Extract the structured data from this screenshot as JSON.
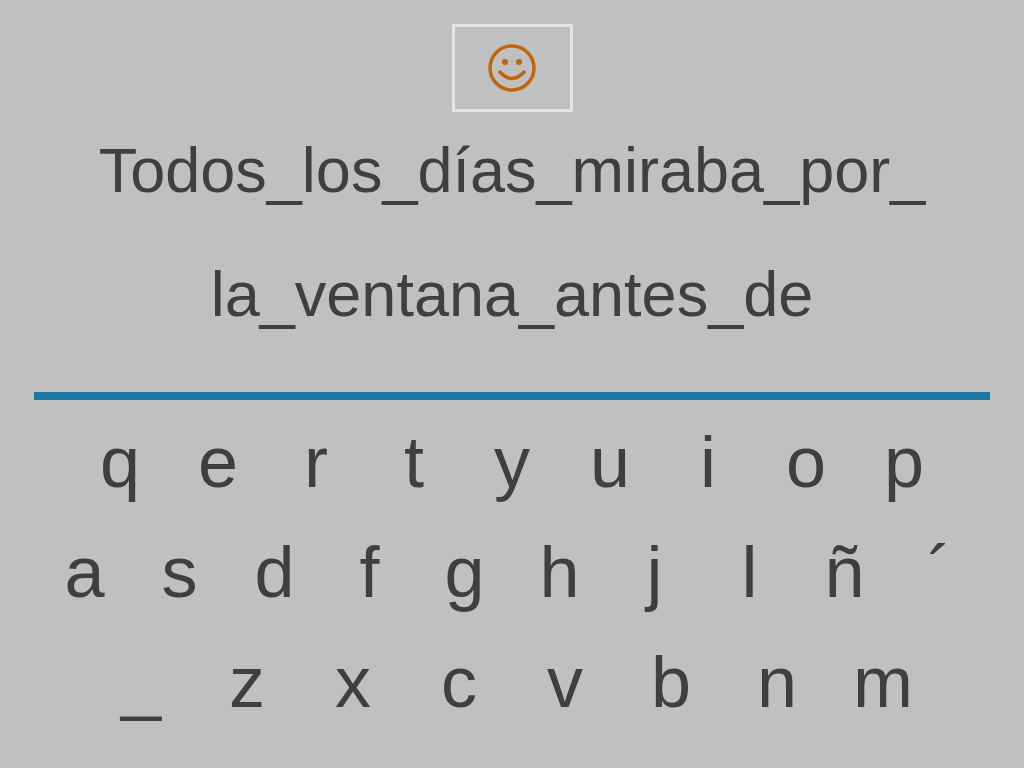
{
  "sentence_lines": [
    "Todos_los_días_miraba_por_",
    "la_ventana_antes_de"
  ],
  "keyboard_rows": [
    [
      "q",
      "e",
      "r",
      "t",
      "y",
      "u",
      "i",
      "o",
      "p"
    ],
    [
      "a",
      "s",
      "d",
      "f",
      "g",
      "h",
      "j",
      "l",
      "ñ",
      "´"
    ],
    [
      "_",
      "z",
      "x",
      "c",
      "v",
      "b",
      "n",
      "m"
    ]
  ]
}
